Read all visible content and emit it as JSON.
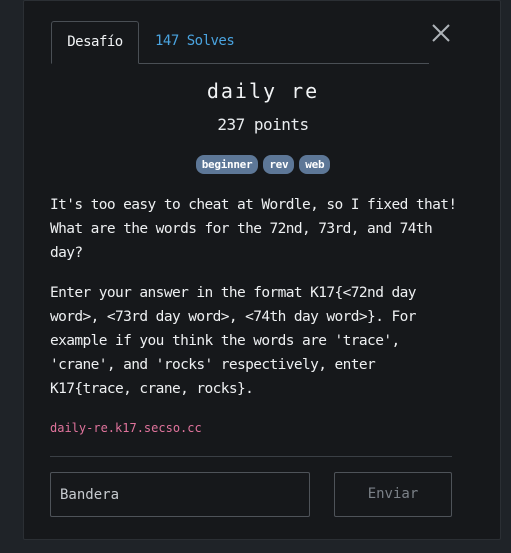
{
  "tabs": {
    "challenge_label": "Desafío",
    "solves_label": "147 Solves"
  },
  "challenge": {
    "name": "daily re",
    "points": "237 points",
    "tags": [
      "beginner",
      "rev",
      "web"
    ],
    "description_1": "It's too easy to cheat at Wordle, so I fixed that! What are the words for the 72nd, 73rd, and 74th day?",
    "description_2": "Enter your answer in the format K17{<72nd day word>, <73rd day word>, <74th day word>}. For example if you think the words are 'trace', 'crane', and 'rocks' respectively, enter K17{trace, crane, rocks}.",
    "link": "daily-re.k17.secso.cc"
  },
  "form": {
    "flag_placeholder": "Bandera",
    "submit_label": "Enviar"
  },
  "icons": {
    "close": "close-icon"
  },
  "colors": {
    "accent": "#4aa3df",
    "tag": "#5d7797",
    "link": "#e0739c"
  }
}
